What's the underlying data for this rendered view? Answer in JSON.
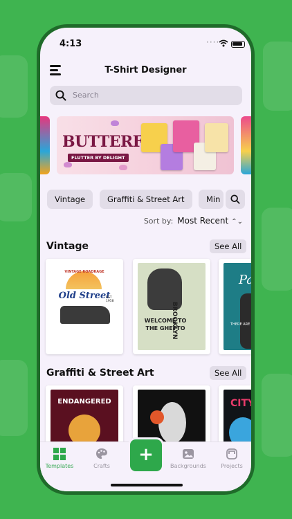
{
  "status": {
    "time": "4:13"
  },
  "header": {
    "title": "T-Shirt Designer"
  },
  "search": {
    "placeholder": "Search"
  },
  "banner": {
    "title": "BUTTERFLY",
    "subtitle": "FLUTTER BY DELIGHT"
  },
  "chips": [
    "Vintage",
    "Graffiti & Street Art",
    "Min"
  ],
  "sort": {
    "label": "Sort by:",
    "value": "Most Recent"
  },
  "sections": [
    {
      "title": "Vintage",
      "see_all": "See All",
      "tiles": [
        {
          "text_top": "VINTAGE ROADRAGE",
          "text_main": "Old Street",
          "text_sub": "EST 1958"
        },
        {
          "text_top": "BROOKLYN",
          "text_main": "WELCOME TO THE GHETTO"
        },
        {
          "text_main": "Pa",
          "text_sub": "THERE ARE"
        }
      ]
    },
    {
      "title": "Graffiti & Street Art",
      "see_all": "See All",
      "tiles": [
        {
          "text_main": "ENDANGERED"
        },
        {
          "text_main": ""
        },
        {
          "text_main": "CITY"
        }
      ]
    }
  ],
  "tabs": [
    {
      "label": "Templates",
      "icon": "grid-icon",
      "active": true
    },
    {
      "label": "Crafts",
      "icon": "palette-icon",
      "active": false
    },
    {
      "label": "Backgrounds",
      "icon": "image-icon",
      "active": false
    },
    {
      "label": "Projects",
      "icon": "projects-icon",
      "active": false
    }
  ],
  "fab": {
    "label": "+"
  },
  "colors": {
    "accent": "#2ea84b",
    "background": "#3fb450",
    "screen": "#f6f1fb",
    "chip": "#e2dde8"
  }
}
